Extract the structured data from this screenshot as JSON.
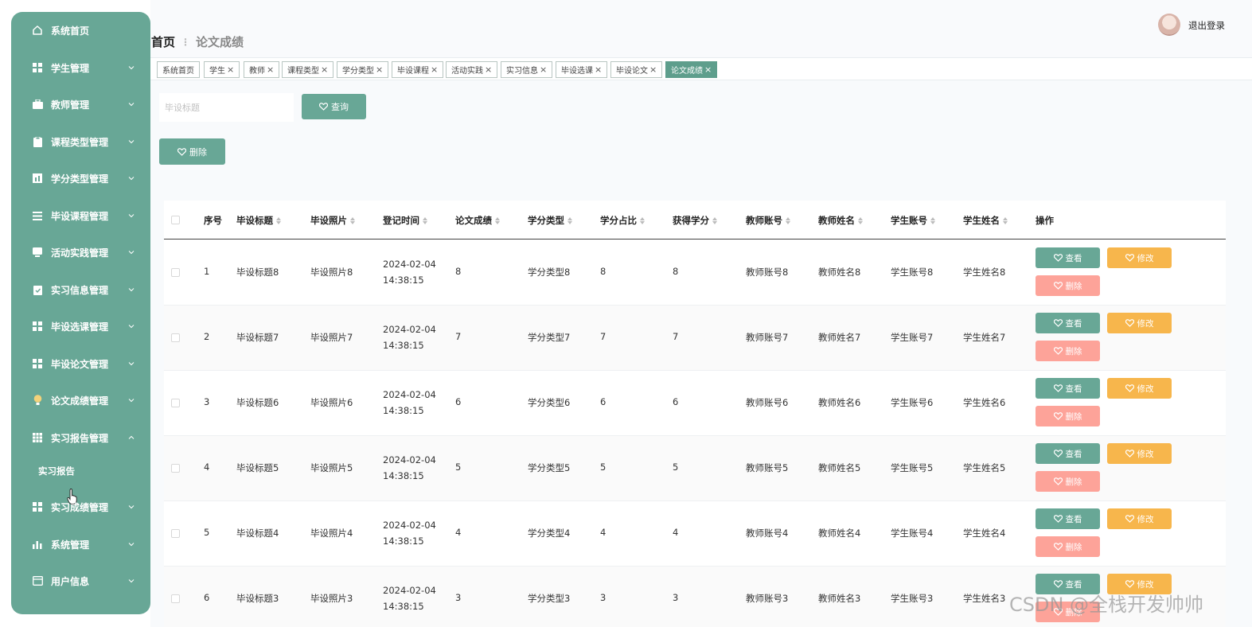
{
  "sidebar": {
    "items": [
      {
        "label": "系统首页",
        "icon": "home-icon"
      },
      {
        "label": "学生管理",
        "icon": "grid-icon"
      },
      {
        "label": "教师管理",
        "icon": "briefcase-icon"
      },
      {
        "label": "课程类型管理",
        "icon": "clipboard-icon"
      },
      {
        "label": "学分类型管理",
        "icon": "chart-icon"
      },
      {
        "label": "毕设课程管理",
        "icon": "list-icon"
      },
      {
        "label": "活动实践管理",
        "icon": "monitor-icon"
      },
      {
        "label": "实习信息管理",
        "icon": "clipboard-check-icon"
      },
      {
        "label": "毕设选课管理",
        "icon": "grid-icon"
      },
      {
        "label": "毕设论文管理",
        "icon": "grid-icon"
      },
      {
        "label": "论文成绩管理",
        "icon": "lightbulb-icon"
      },
      {
        "label": "实习报告管理",
        "icon": "table-icon"
      },
      {
        "label": "实习成绩管理",
        "icon": "grid-icon"
      },
      {
        "label": "系统管理",
        "icon": "bar-chart-icon"
      },
      {
        "label": "用户信息",
        "icon": "window-icon"
      }
    ],
    "submenu_label": "实习报告"
  },
  "header": {
    "breadcrumb_home": "首页",
    "breadcrumb_current": "论文成绩",
    "logout": "退出登录"
  },
  "tags": [
    "系统首页",
    "学生",
    "教师",
    "课程类型",
    "学分类型",
    "毕设课程",
    "活动实践",
    "实习信息",
    "毕设选课",
    "毕设论文",
    "论文成绩"
  ],
  "search": {
    "placeholder": "毕设标题",
    "button": "查询"
  },
  "toolbar": {
    "delete": "删除"
  },
  "table": {
    "headers": [
      "序号",
      "毕设标题",
      "毕设照片",
      "登记时间",
      "论文成绩",
      "学分类型",
      "学分占比",
      "获得学分",
      "教师账号",
      "教师姓名",
      "学生账号",
      "学生姓名",
      "操作"
    ],
    "rows": [
      {
        "index": "1",
        "title": "毕设标题8",
        "photo": "毕设照片8",
        "date": "2024-02-04",
        "time": "14:38:15",
        "score": "8",
        "credit_type": "学分类型8",
        "ratio": "8",
        "credit": "8",
        "teacher_account": "教师账号8",
        "teacher_name": "教师姓名8",
        "student_account": "学生账号8",
        "student_name": "学生姓名8"
      },
      {
        "index": "2",
        "title": "毕设标题7",
        "photo": "毕设照片7",
        "date": "2024-02-04",
        "time": "14:38:15",
        "score": "7",
        "credit_type": "学分类型7",
        "ratio": "7",
        "credit": "7",
        "teacher_account": "教师账号7",
        "teacher_name": "教师姓名7",
        "student_account": "学生账号7",
        "student_name": "学生姓名7"
      },
      {
        "index": "3",
        "title": "毕设标题6",
        "photo": "毕设照片6",
        "date": "2024-02-04",
        "time": "14:38:15",
        "score": "6",
        "credit_type": "学分类型6",
        "ratio": "6",
        "credit": "6",
        "teacher_account": "教师账号6",
        "teacher_name": "教师姓名6",
        "student_account": "学生账号6",
        "student_name": "学生姓名6"
      },
      {
        "index": "4",
        "title": "毕设标题5",
        "photo": "毕设照片5",
        "date": "2024-02-04",
        "time": "14:38:15",
        "score": "5",
        "credit_type": "学分类型5",
        "ratio": "5",
        "credit": "5",
        "teacher_account": "教师账号5",
        "teacher_name": "教师姓名5",
        "student_account": "学生账号5",
        "student_name": "学生姓名5"
      },
      {
        "index": "5",
        "title": "毕设标题4",
        "photo": "毕设照片4",
        "date": "2024-02-04",
        "time": "14:38:15",
        "score": "4",
        "credit_type": "学分类型4",
        "ratio": "4",
        "credit": "4",
        "teacher_account": "教师账号4",
        "teacher_name": "教师姓名4",
        "student_account": "学生账号4",
        "student_name": "学生姓名4"
      },
      {
        "index": "6",
        "title": "毕设标题3",
        "photo": "毕设照片3",
        "date": "2024-02-04",
        "time": "14:38:15",
        "score": "3",
        "credit_type": "学分类型3",
        "ratio": "3",
        "credit": "3",
        "teacher_account": "教师账号3",
        "teacher_name": "教师姓名3",
        "student_account": "学生账号3",
        "student_name": "学生姓名3"
      }
    ],
    "actions": {
      "view": "查看",
      "edit": "修改",
      "delete": "删除"
    }
  },
  "watermark": "CSDN @全栈开发帅帅",
  "colors": {
    "primary": "#68a796",
    "edit": "#f7b64c",
    "delete": "#fda399",
    "active_tag": "#5e9e8c"
  }
}
